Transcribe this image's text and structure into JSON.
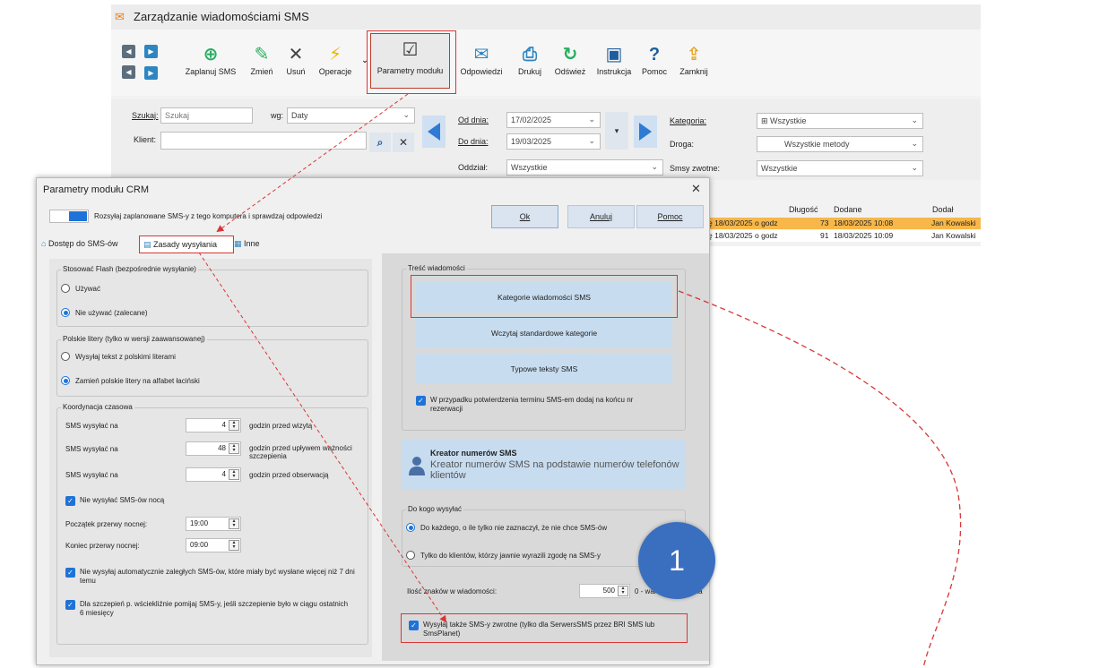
{
  "main": {
    "title": "Zarządzanie wiadomościami SMS",
    "toolbar": {
      "schedule": "Zaplanuj SMS",
      "change": "Zmień",
      "delete": "Usuń",
      "operations": "Operacje",
      "params": "Parametry modułu",
      "replies": "Odpowiedzi",
      "print": "Drukuj",
      "refresh": "Odśwież",
      "instruction": "Instrukcja",
      "help": "Pomoc",
      "close": "Zamknij"
    },
    "filters": {
      "search_label": "Szukaj:",
      "search_value": "Szukaj",
      "by_label": "wg:",
      "by_value": "Daty",
      "client_label": "Klient:",
      "from_label": "Od dnia:",
      "from_value": "17/02/2025",
      "to_label": "Do dnia:",
      "to_value": "19/03/2025",
      "branch_label": "Oddział:",
      "branch_value": "Wszystkie",
      "category_label": "Kategoria:",
      "category_value": "Wszystkie",
      "route_label": "Droga:",
      "route_value": "Wszystkie metody",
      "return_label": "Smsy zwotne:",
      "return_value": "Wszystkie"
    },
    "grid": {
      "headers": [
        "Długość",
        "Dodane",
        "Dodał"
      ],
      "rows": [
        {
          "text": "ę 18/03/2025 o godz",
          "length": "73",
          "added": "18/03/2025 10:08",
          "by": "Jan Kowalski"
        },
        {
          "text": "ę 18/03/2025 o godz",
          "length": "91",
          "added": "18/03/2025 10:09",
          "by": "Jan Kowalski"
        }
      ]
    }
  },
  "dialog": {
    "title": "Parametry modułu CRM",
    "toggle_label": "Rozsyłaj zaplanowane SMS-y z tego komputera i sprawdzaj odpowiedzi",
    "ok": "Ok",
    "cancel": "Anuluj",
    "help": "Pomoc",
    "tabs": [
      "Dostęp do SMS-ów",
      "Zasady wysyłania",
      "Inne"
    ],
    "flash": {
      "legend": "Stosować Flash (bezpośrednie wysyłanie)",
      "opt1": "Używać",
      "opt2": "Nie używać (zalecane)"
    },
    "polish": {
      "legend": "Polskie litery (tylko w wersji zaawansowanej)",
      "opt1": "Wysyłaj tekst z polskimi literami",
      "opt2": "Zamień polskie litery na alfabet łaciński"
    },
    "timing": {
      "legend": "Koordynacja czasowa",
      "row1_label": "SMS wysyłać na",
      "row1_value": "4",
      "row1_suffix": "godzin przed wizytą",
      "row2_label": "SMS wysyłać na",
      "row2_value": "48",
      "row2_suffix": "godzin przed upływem ważności szczepienia",
      "row3_label": "SMS wysyłać na",
      "row3_value": "4",
      "row3_suffix": "godzin przed obserwacją",
      "no_night": "Nie wysyłać SMS-ów nocą",
      "night_start_label": "Początek przerwy nocnej:",
      "night_start": "19:00",
      "night_end_label": "Koniec przerwy nocnej:",
      "night_end": "09:00",
      "no_overdue": "Nie wysyłaj automatycznie zaległych SMS-ów, które miały być wysłane więcej niż 7 dni temu",
      "rabies": "Dla szczepień p. wściekliźnie pomijaj SMS-y, jeśli szczepienie było w ciągu ostatnich 6 miesięcy"
    },
    "content": {
      "legend": "Treść wiadomości",
      "btn_categories": "Kategorie wiadomości SMS",
      "btn_load": "Wczytaj standardowe kategorie",
      "btn_typical": "Typowe teksty SMS",
      "confirm_check": "W przypadku potwierdzenia terminu SMS-em dodaj na końcu nr rezerwacji"
    },
    "wizard": {
      "title": "Kreator numerów SMS",
      "desc": "Kreator numerów SMS na podstawie numerów telefonów klientów"
    },
    "recipients": {
      "legend": "Do kogo wysyłać",
      "opt1": "Do każdego, o ile tylko nie zaznaczył, że nie chce SMS-ów",
      "opt2": "Tylko do klientów, którzy jawnie wyrazili zgodę na SMS-y"
    },
    "chars_label": "Ilość znaków w wiadomości:",
    "chars_value": "500",
    "chars_suffix": "0 - wartość domyślna",
    "return_check": "Wysyłaj także SMS-y zwrotne (tylko dla SerwersSMS przez BRI SMS lub SmsPlanet)"
  },
  "annotation": {
    "badge": "1"
  },
  "colors": {
    "accent": "#1e73d8",
    "highlight": "#d93636",
    "selected_row": "#f7b74a",
    "badge": "#3a6fc0"
  }
}
